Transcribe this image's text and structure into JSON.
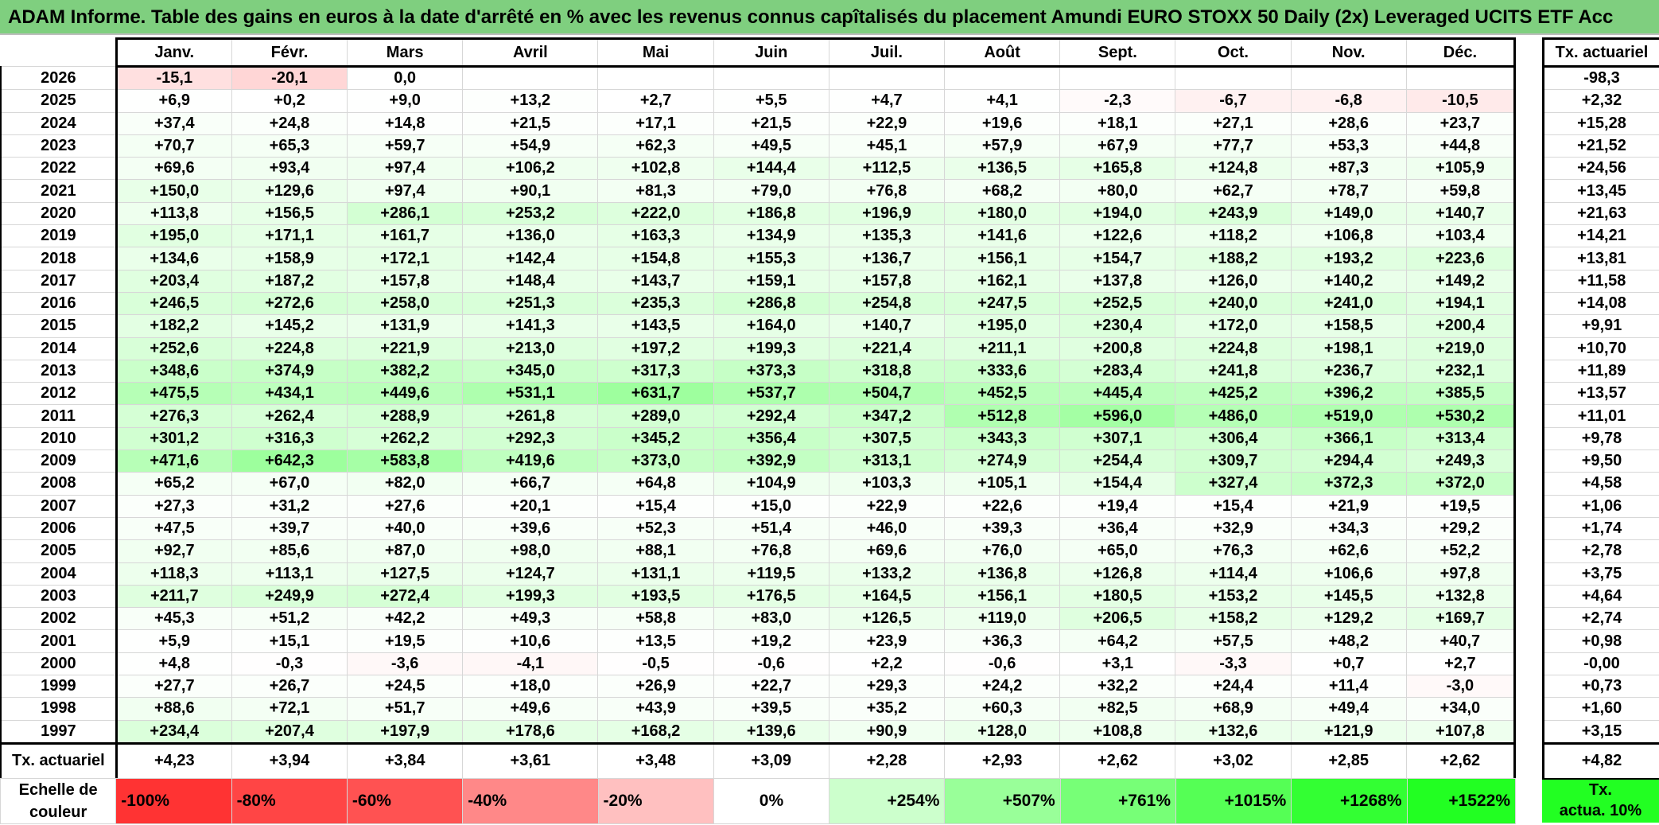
{
  "title": "ADAM Informe. Table des gains en euros à la date d'arrêté en % avec les revenus connus capîtalisés du placement Amundi EURO STOXX 50 Daily (2x) Leveraged UCITS ETF Acc",
  "months": [
    "Janv.",
    "Févr.",
    "Mars",
    "Avril",
    "Mai",
    "Juin",
    "Juil.",
    "Août",
    "Sept.",
    "Oct.",
    "Nov.",
    "Déc."
  ],
  "rate_header": "Tx. actuariel",
  "rows": [
    {
      "year": "2026",
      "values": [
        "-15,1",
        "-20,1",
        "0,0",
        "",
        "",
        "",
        "",
        "",
        "",
        "",
        "",
        ""
      ],
      "rate": "-98,3"
    },
    {
      "year": "2025",
      "values": [
        "+6,9",
        "+0,2",
        "+9,0",
        "+13,2",
        "+2,7",
        "+5,5",
        "+4,7",
        "+4,1",
        "-2,3",
        "-6,7",
        "-6,8",
        "-10,5"
      ],
      "rate": "+2,32"
    },
    {
      "year": "2024",
      "values": [
        "+37,4",
        "+24,8",
        "+14,8",
        "+21,5",
        "+17,1",
        "+21,5",
        "+22,9",
        "+19,6",
        "+18,1",
        "+27,1",
        "+28,6",
        "+23,7"
      ],
      "rate": "+15,28"
    },
    {
      "year": "2023",
      "values": [
        "+70,7",
        "+65,3",
        "+59,7",
        "+54,9",
        "+62,3",
        "+49,5",
        "+45,1",
        "+57,9",
        "+67,9",
        "+77,7",
        "+53,3",
        "+44,8"
      ],
      "rate": "+21,52"
    },
    {
      "year": "2022",
      "values": [
        "+69,6",
        "+93,4",
        "+97,4",
        "+106,2",
        "+102,8",
        "+144,4",
        "+112,5",
        "+136,5",
        "+165,8",
        "+124,8",
        "+87,3",
        "+105,9"
      ],
      "rate": "+24,56"
    },
    {
      "year": "2021",
      "values": [
        "+150,0",
        "+129,6",
        "+97,4",
        "+90,1",
        "+81,3",
        "+79,0",
        "+76,8",
        "+68,2",
        "+80,0",
        "+62,7",
        "+78,7",
        "+59,8"
      ],
      "rate": "+13,45"
    },
    {
      "year": "2020",
      "values": [
        "+113,8",
        "+156,5",
        "+286,1",
        "+253,2",
        "+222,0",
        "+186,8",
        "+196,9",
        "+180,0",
        "+194,0",
        "+243,9",
        "+149,0",
        "+140,7"
      ],
      "rate": "+21,63"
    },
    {
      "year": "2019",
      "values": [
        "+195,0",
        "+171,1",
        "+161,7",
        "+136,0",
        "+163,3",
        "+134,9",
        "+135,3",
        "+141,6",
        "+122,6",
        "+118,2",
        "+106,8",
        "+103,4"
      ],
      "rate": "+14,21"
    },
    {
      "year": "2018",
      "values": [
        "+134,6",
        "+158,9",
        "+172,1",
        "+142,4",
        "+154,8",
        "+155,3",
        "+136,7",
        "+156,1",
        "+154,7",
        "+188,2",
        "+193,2",
        "+223,6"
      ],
      "rate": "+13,81"
    },
    {
      "year": "2017",
      "values": [
        "+203,4",
        "+187,2",
        "+157,8",
        "+148,4",
        "+143,7",
        "+159,1",
        "+157,8",
        "+162,1",
        "+137,8",
        "+126,0",
        "+140,2",
        "+149,2"
      ],
      "rate": "+11,58"
    },
    {
      "year": "2016",
      "values": [
        "+246,5",
        "+272,6",
        "+258,0",
        "+251,3",
        "+235,3",
        "+286,8",
        "+254,8",
        "+247,5",
        "+252,5",
        "+240,0",
        "+241,0",
        "+194,1"
      ],
      "rate": "+14,08"
    },
    {
      "year": "2015",
      "values": [
        "+182,2",
        "+145,2",
        "+131,9",
        "+141,3",
        "+143,5",
        "+164,0",
        "+140,7",
        "+195,0",
        "+230,4",
        "+172,0",
        "+158,5",
        "+200,4"
      ],
      "rate": "+9,91"
    },
    {
      "year": "2014",
      "values": [
        "+252,6",
        "+224,8",
        "+221,9",
        "+213,0",
        "+197,2",
        "+199,3",
        "+221,4",
        "+211,1",
        "+200,8",
        "+224,8",
        "+198,1",
        "+219,0"
      ],
      "rate": "+10,70"
    },
    {
      "year": "2013",
      "values": [
        "+348,6",
        "+374,9",
        "+382,2",
        "+345,0",
        "+317,3",
        "+373,3",
        "+318,8",
        "+333,6",
        "+283,4",
        "+241,8",
        "+236,7",
        "+232,1"
      ],
      "rate": "+11,89"
    },
    {
      "year": "2012",
      "values": [
        "+475,5",
        "+434,1",
        "+449,6",
        "+531,1",
        "+631,7",
        "+537,7",
        "+504,7",
        "+452,5",
        "+445,4",
        "+425,2",
        "+396,2",
        "+385,5"
      ],
      "rate": "+13,57"
    },
    {
      "year": "2011",
      "values": [
        "+276,3",
        "+262,4",
        "+288,9",
        "+261,8",
        "+289,0",
        "+292,4",
        "+347,2",
        "+512,8",
        "+596,0",
        "+486,0",
        "+519,0",
        "+530,2"
      ],
      "rate": "+11,01"
    },
    {
      "year": "2010",
      "values": [
        "+301,2",
        "+316,3",
        "+262,2",
        "+292,3",
        "+345,2",
        "+356,4",
        "+307,5",
        "+343,3",
        "+307,1",
        "+306,4",
        "+366,1",
        "+313,4"
      ],
      "rate": "+9,78"
    },
    {
      "year": "2009",
      "values": [
        "+471,6",
        "+642,3",
        "+583,8",
        "+419,6",
        "+373,0",
        "+392,9",
        "+313,1",
        "+274,9",
        "+254,4",
        "+309,7",
        "+294,4",
        "+249,3"
      ],
      "rate": "+9,50"
    },
    {
      "year": "2008",
      "values": [
        "+65,2",
        "+67,0",
        "+82,0",
        "+66,7",
        "+64,8",
        "+104,9",
        "+103,3",
        "+105,1",
        "+154,4",
        "+327,4",
        "+372,3",
        "+372,0"
      ],
      "rate": "+4,58"
    },
    {
      "year": "2007",
      "values": [
        "+27,3",
        "+31,2",
        "+27,6",
        "+20,1",
        "+15,4",
        "+15,0",
        "+22,9",
        "+22,6",
        "+19,4",
        "+15,4",
        "+21,9",
        "+19,5"
      ],
      "rate": "+1,06"
    },
    {
      "year": "2006",
      "values": [
        "+47,5",
        "+39,7",
        "+40,0",
        "+39,6",
        "+52,3",
        "+51,4",
        "+46,0",
        "+39,3",
        "+36,4",
        "+32,9",
        "+34,3",
        "+29,2"
      ],
      "rate": "+1,74"
    },
    {
      "year": "2005",
      "values": [
        "+92,7",
        "+85,6",
        "+87,0",
        "+98,0",
        "+88,1",
        "+76,8",
        "+69,6",
        "+76,0",
        "+65,0",
        "+76,3",
        "+62,6",
        "+52,2"
      ],
      "rate": "+2,78"
    },
    {
      "year": "2004",
      "values": [
        "+118,3",
        "+113,1",
        "+127,5",
        "+124,7",
        "+131,1",
        "+119,5",
        "+133,2",
        "+136,8",
        "+126,8",
        "+114,4",
        "+106,6",
        "+97,8"
      ],
      "rate": "+3,75"
    },
    {
      "year": "2003",
      "values": [
        "+211,7",
        "+249,9",
        "+272,4",
        "+199,3",
        "+193,5",
        "+176,5",
        "+164,5",
        "+156,1",
        "+180,5",
        "+153,2",
        "+145,5",
        "+132,8"
      ],
      "rate": "+4,64"
    },
    {
      "year": "2002",
      "values": [
        "+45,3",
        "+51,2",
        "+42,2",
        "+49,3",
        "+58,8",
        "+83,0",
        "+126,5",
        "+119,0",
        "+206,5",
        "+158,2",
        "+129,2",
        "+169,7"
      ],
      "rate": "+2,74"
    },
    {
      "year": "2001",
      "values": [
        "+5,9",
        "+15,1",
        "+19,5",
        "+10,6",
        "+13,5",
        "+19,2",
        "+23,9",
        "+36,3",
        "+64,2",
        "+57,5",
        "+48,2",
        "+40,7"
      ],
      "rate": "+0,98"
    },
    {
      "year": "2000",
      "values": [
        "+4,8",
        "-0,3",
        "-3,6",
        "-4,1",
        "-0,5",
        "-0,6",
        "+2,2",
        "-0,6",
        "+3,1",
        "-3,3",
        "+0,7",
        "+2,7"
      ],
      "rate": "-0,00"
    },
    {
      "year": "1999",
      "values": [
        "+27,7",
        "+26,7",
        "+24,5",
        "+18,0",
        "+26,9",
        "+22,7",
        "+29,3",
        "+24,2",
        "+32,2",
        "+24,4",
        "+11,4",
        "-3,0"
      ],
      "rate": "+0,73"
    },
    {
      "year": "1998",
      "values": [
        "+88,6",
        "+72,1",
        "+51,7",
        "+49,6",
        "+43,9",
        "+39,5",
        "+35,2",
        "+60,3",
        "+82,5",
        "+68,9",
        "+49,4",
        "+34,0"
      ],
      "rate": "+1,60"
    },
    {
      "year": "1997",
      "values": [
        "+234,4",
        "+207,4",
        "+197,9",
        "+178,6",
        "+168,2",
        "+139,6",
        "+90,9",
        "+128,0",
        "+108,8",
        "+132,6",
        "+121,9",
        "+107,8"
      ],
      "rate": "+3,15"
    }
  ],
  "annual": {
    "label": "Tx. actuariel",
    "values": [
      "+4,23",
      "+3,94",
      "+3,84",
      "+3,61",
      "+3,48",
      "+3,09",
      "+2,28",
      "+2,93",
      "+2,62",
      "+3,02",
      "+2,85",
      "+2,62"
    ],
    "overall": "+4,82"
  },
  "legend": {
    "label_line1": "Echelle de",
    "label_line2": "couleur",
    "steps": [
      {
        "label": "-100%",
        "color": "#ff3333"
      },
      {
        "label": "-80%",
        "color": "#ff4545"
      },
      {
        "label": "-60%",
        "color": "#ff5252"
      },
      {
        "label": "-40%",
        "color": "#ff8888"
      },
      {
        "label": "-20%",
        "color": "#ffc0c0"
      },
      {
        "label": "0%",
        "color": "#ffffff"
      },
      {
        "label": "+254%",
        "color": "#ccffcc"
      },
      {
        "label": "+507%",
        "color": "#99ff99"
      },
      {
        "label": "+761%",
        "color": "#77ff77"
      },
      {
        "label": "+1015%",
        "color": "#55ff55"
      },
      {
        "label": "+1268%",
        "color": "#33ff33"
      },
      {
        "label": "+1522%",
        "color": "#22ff22"
      }
    ],
    "rate_line1": "Tx.",
    "rate_line2": "actua. 10%",
    "rate_color": "#22ff22"
  },
  "colors": {
    "banner": "#7fcf7f",
    "positive_max": "#22ff22",
    "negative_max": "#ff3333"
  }
}
